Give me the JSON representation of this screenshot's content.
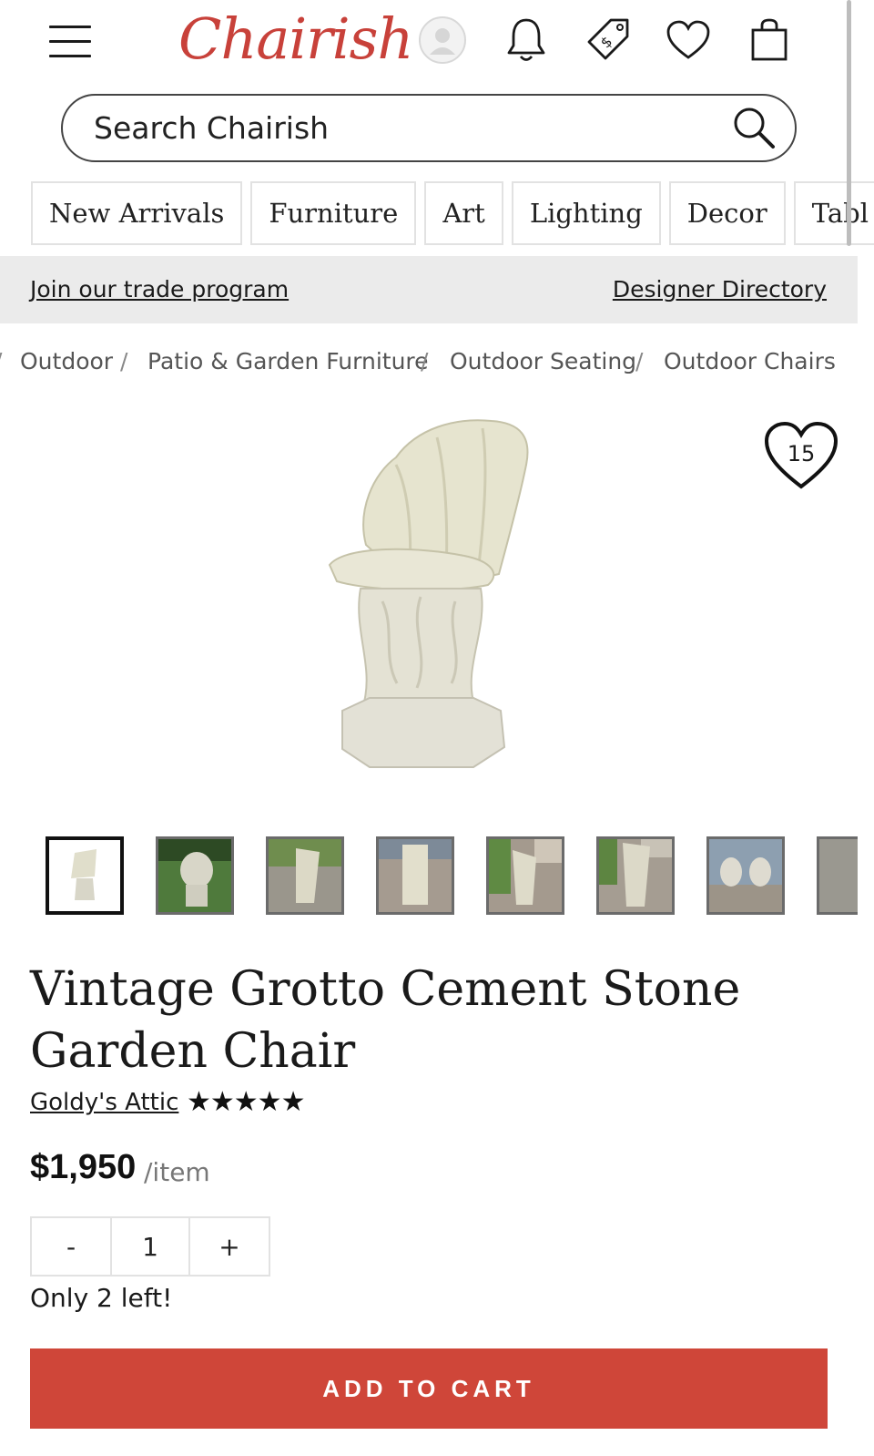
{
  "header": {
    "logo": "Chairish",
    "icons": [
      "menu-icon",
      "avatar-icon",
      "bell-icon",
      "price-tag-icon",
      "heart-icon",
      "shopping-bag-icon"
    ]
  },
  "search": {
    "placeholder": "Search Chairish"
  },
  "categories": [
    "New Arrivals",
    "Furniture",
    "Art",
    "Lighting",
    "Decor",
    "Tabl"
  ],
  "trade_bar": {
    "left_link": "Join our trade program",
    "right_link": "Designer Directory"
  },
  "breadcrumb": [
    "Outdoor",
    "Patio & Garden Furniture",
    "Outdoor Seating",
    "Outdoor Chairs"
  ],
  "favorite": {
    "count": "15"
  },
  "product": {
    "title_line1": "Vintage Grotto Cement Stone",
    "title_line2": "Garden Chair",
    "seller": "Goldy's Attic",
    "rating_stars": "★★★★★",
    "rating": 5,
    "price": "$1,950",
    "price_unit": "/item",
    "quantity": "1",
    "qty_minus": "-",
    "qty_plus": "+",
    "stock_note": "Only 2 left!",
    "add_to_cart": "ADD TO CART"
  },
  "colors": {
    "brand": "#c8413a",
    "cart_button": "#cf4639",
    "trade_bar_bg": "#ebebeb"
  }
}
